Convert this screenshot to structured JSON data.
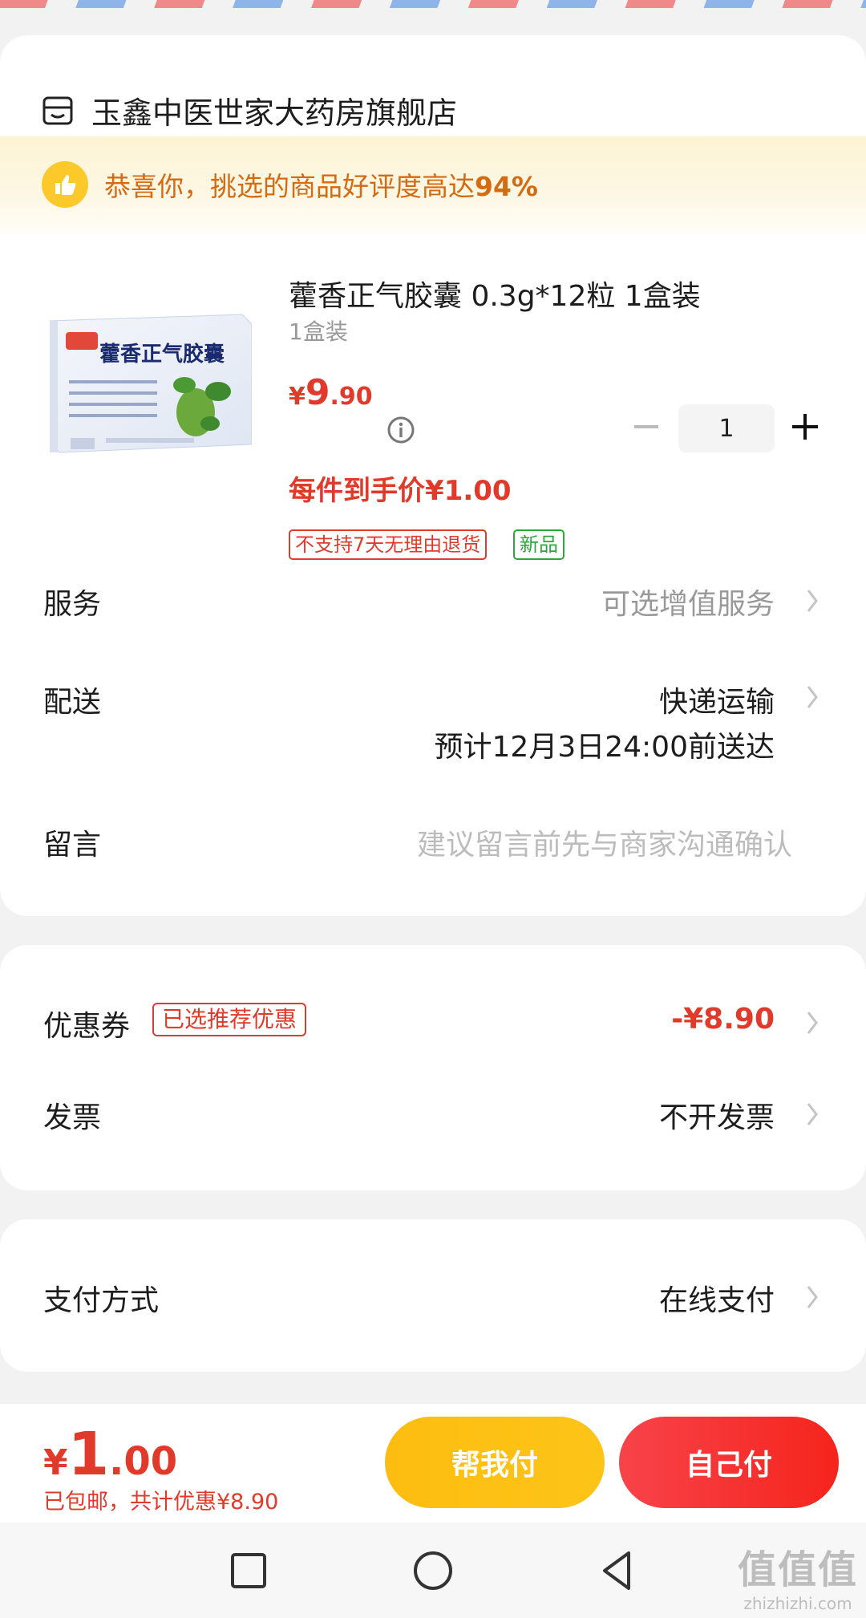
{
  "store": {
    "name": "玉鑫中医世家大药房旗舰店",
    "icon": "store-icon"
  },
  "banner": {
    "text_prefix": "恭喜你，挑选的商品好评度高达",
    "rating": "94%",
    "icon": "thumbs-up-icon"
  },
  "product": {
    "title": "藿香正气胶囊 0.3g*12粒 1盒装",
    "spec": "1盒装",
    "image_text": "藿香正气胶囊",
    "price_currency": "¥",
    "price_int": "9",
    "price_dec": ".90",
    "per_item_price": "每件到手价¥1.00",
    "tags": [
      "不支持7天无理由退货",
      "新品"
    ],
    "quantity": "1"
  },
  "rows": {
    "service": {
      "label": "服务",
      "value": "可选增值服务"
    },
    "delivery": {
      "label": "配送",
      "value": "快递运输",
      "eta": "预计12月3日24:00前送达"
    },
    "message": {
      "label": "留言",
      "placeholder": "建议留言前先与商家沟通确认"
    },
    "coupon": {
      "label": "优惠券",
      "badge": "已选推荐优惠",
      "value": "-¥8.90"
    },
    "invoice": {
      "label": "发票",
      "value": "不开发票"
    },
    "payment": {
      "label": "支付方式",
      "value": "在线支付"
    }
  },
  "footer": {
    "total_currency": "¥",
    "total_int": "1",
    "total_dec": ".00",
    "note": "已包邮，共计优惠¥8.90",
    "help_pay_label": "帮我付",
    "self_pay_label": "自己付"
  },
  "watermark": {
    "big": "值值值",
    "small": "zhizhizhi.com"
  },
  "colors": {
    "accent_red": "#e23a2a",
    "banner_orange": "#d46a12",
    "help_pay_yellow": "#fdbd10",
    "self_pay_red": "#f6241c",
    "tag_green": "#29a83c"
  }
}
